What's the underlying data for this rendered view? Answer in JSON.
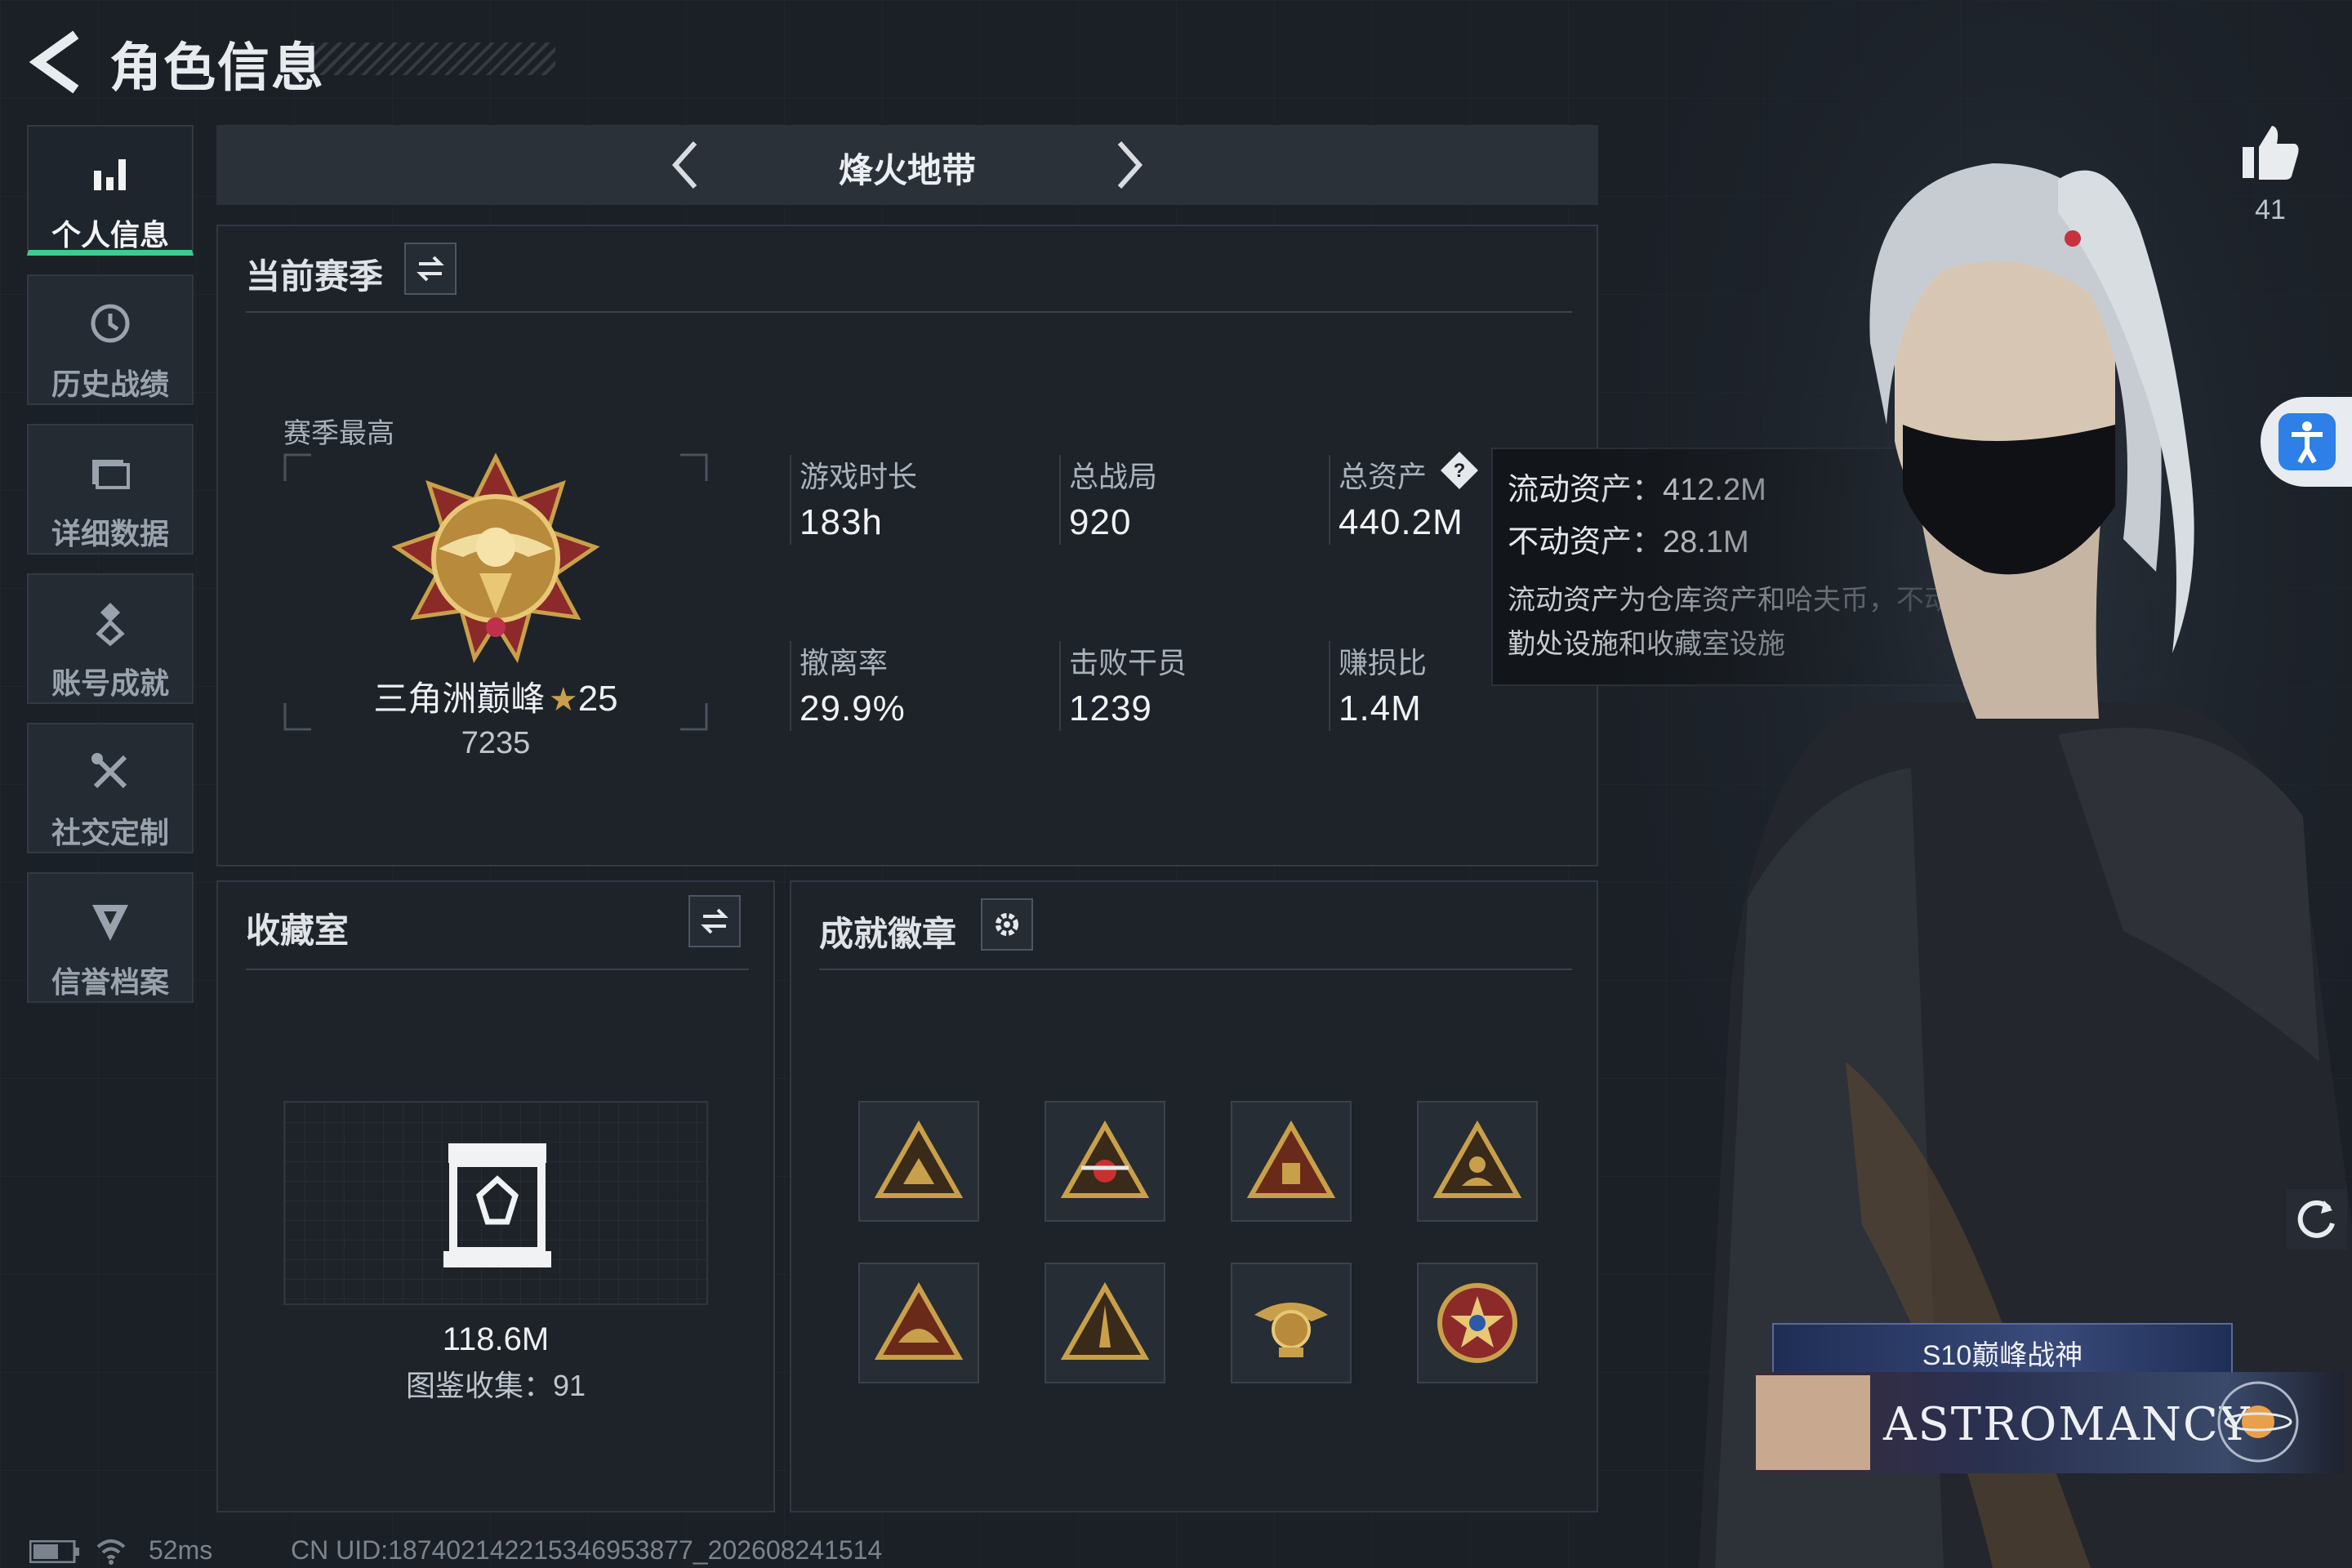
{
  "header": {
    "title": "角色信息"
  },
  "nav": {
    "items": [
      {
        "label": "个人信息",
        "icon": "bar-chart-icon",
        "active": true
      },
      {
        "label": "历史战绩",
        "icon": "history-icon"
      },
      {
        "label": "详细数据",
        "icon": "folder-icon"
      },
      {
        "label": "账号成就",
        "icon": "achievement-icon"
      },
      {
        "label": "社交定制",
        "icon": "tools-icon"
      },
      {
        "label": "信誉档案",
        "icon": "shield-icon"
      }
    ]
  },
  "mode": {
    "title": "烽火地带"
  },
  "season": {
    "title": "当前赛季",
    "best_label": "赛季最高",
    "rank_name": "三角洲巅峰",
    "rank_stars": "25",
    "rank_score": "7235",
    "stats": [
      {
        "label": "游戏时长",
        "value": "183h"
      },
      {
        "label": "总战局",
        "value": "920"
      },
      {
        "label": "总资产",
        "value": "440.2M"
      },
      {
        "label": "撤离率",
        "value": "29.9%"
      },
      {
        "label": "击败干员",
        "value": "1239"
      },
      {
        "label": "赚损比",
        "value": "1.4M"
      }
    ]
  },
  "tooltip": {
    "liquid": "流动资产：412.2M",
    "fixed": "不动资产：28.1M",
    "desc": "流动资产为仓库资产和哈夫币，不动资产为特勤处设施和收藏室设施"
  },
  "collection": {
    "title": "收藏室",
    "value": "118.6M",
    "collect_label": "图鉴收集：91"
  },
  "achievements": {
    "title": "成就徽章",
    "badges": [
      "badge-1",
      "badge-2",
      "badge-3",
      "badge-4",
      "badge-5",
      "badge-6",
      "badge-7",
      "badge-8"
    ]
  },
  "likes": {
    "count": "41"
  },
  "character": {
    "title_card": "S10巅峰战神",
    "banner_text": "ASTROMANCY"
  },
  "status": {
    "ping": "52ms",
    "uid": "CN UID:187402142215346953877_202608241514"
  },
  "colors": {
    "accent": "#3dcc8e",
    "gold": "#c9a04a",
    "accessibility": "#2e7fe8"
  }
}
